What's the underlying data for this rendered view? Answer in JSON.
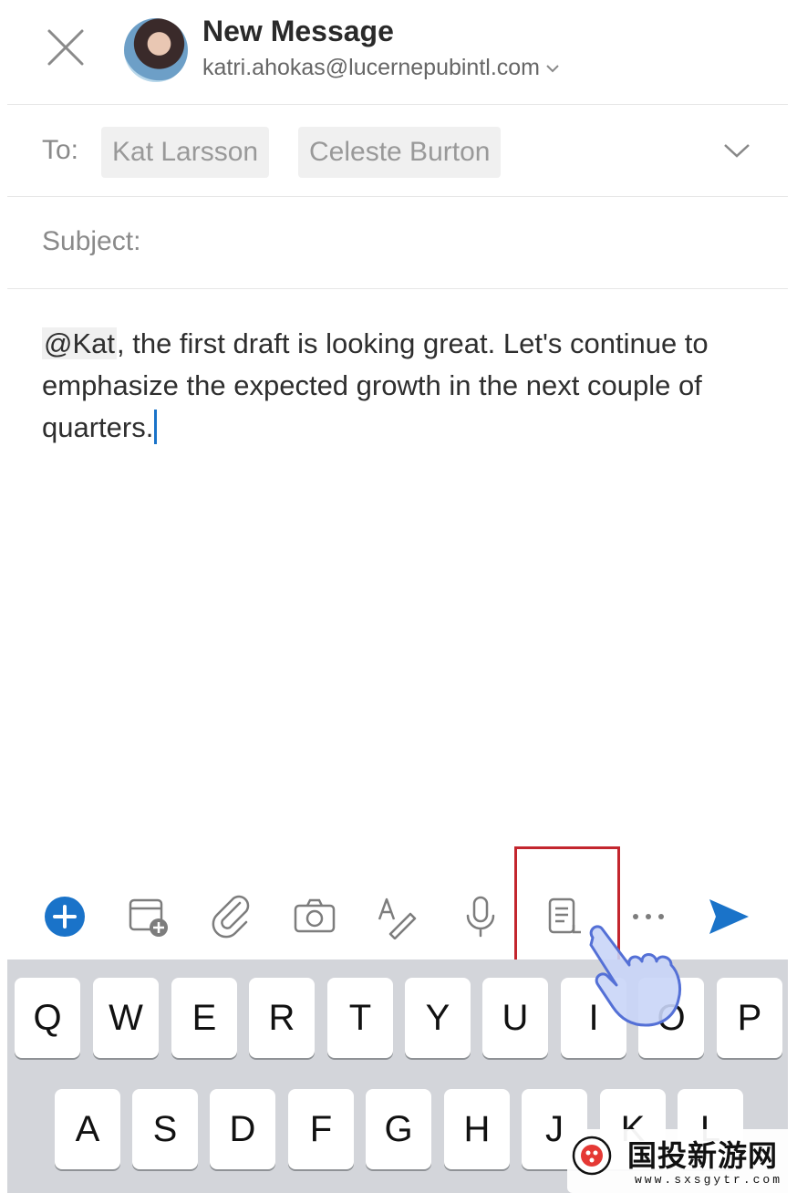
{
  "header": {
    "title": "New Message",
    "account": "katri.ahokas@lucernepubintl.com"
  },
  "to": {
    "label": "To:",
    "recipients": [
      "Kat Larsson",
      "Celeste Burton"
    ]
  },
  "subject": {
    "label": "Subject:",
    "value": ""
  },
  "body": {
    "mention": "@Kat",
    "text": ", the first draft is looking great. Let's continue to emphasize the expected growth in the next couple of quarters."
  },
  "toolbar": {
    "icons": [
      "add-icon",
      "calendar-add-icon",
      "attach-icon",
      "camera-icon",
      "format-icon",
      "microphone-icon",
      "template-icon",
      "more-icon",
      "send-icon"
    ],
    "accent": "#1a73c9",
    "highlighted": "template-icon"
  },
  "keyboard": {
    "row1": [
      "Q",
      "W",
      "E",
      "R",
      "T",
      "Y",
      "U",
      "I",
      "O",
      "P"
    ],
    "row2": [
      "A",
      "S",
      "D",
      "F",
      "G",
      "H",
      "J",
      "K",
      "L"
    ]
  },
  "watermark": {
    "name": "国投新游网",
    "url": "www.sxsgytr.com"
  }
}
